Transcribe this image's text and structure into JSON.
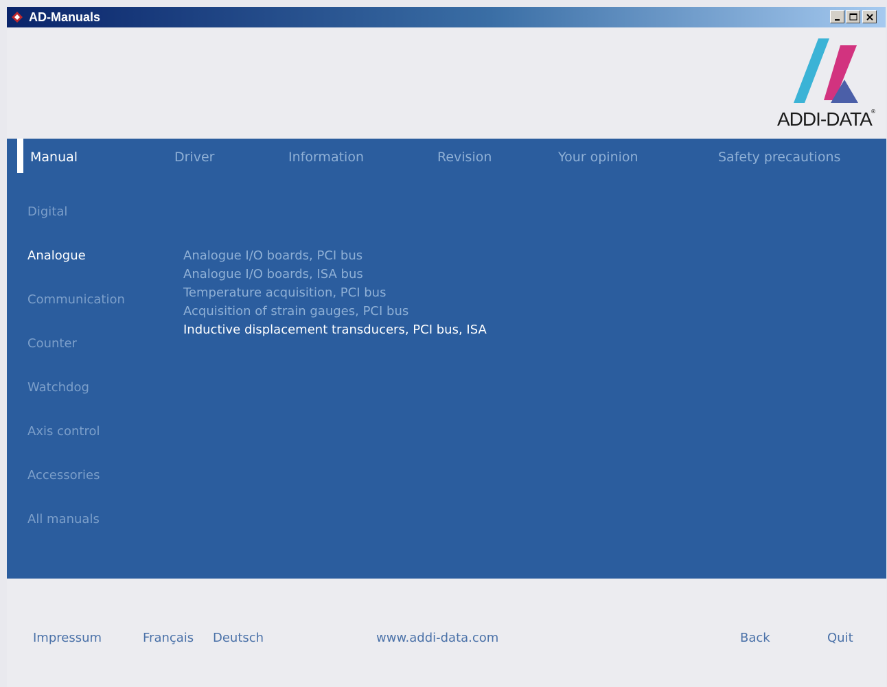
{
  "window": {
    "title": "AD-Manuals"
  },
  "logo": {
    "text": "ADDI-DATA",
    "registered": "®"
  },
  "tabs": [
    {
      "label": "Manual",
      "active": true
    },
    {
      "label": "Driver"
    },
    {
      "label": "Information"
    },
    {
      "label": "Revision"
    },
    {
      "label": "Your opinion"
    },
    {
      "label": "Safety precautions"
    }
  ],
  "categories": [
    {
      "label": "Digital"
    },
    {
      "label": "Analogue",
      "active": true
    },
    {
      "label": "Communication"
    },
    {
      "label": "Counter"
    },
    {
      "label": "Watchdog"
    },
    {
      "label": "Axis control"
    },
    {
      "label": "Accessories"
    },
    {
      "label": "All manuals"
    }
  ],
  "subitems": [
    {
      "label": "Analogue I/O boards, PCI bus"
    },
    {
      "label": "Analogue I/O boards, ISA bus"
    },
    {
      "label": "Temperature acquisition, PCI bus"
    },
    {
      "label": "Acquisition of strain gauges, PCI bus"
    },
    {
      "label": "Inductive displacement transducers, PCI bus, ISA",
      "highlighted": true
    }
  ],
  "footer": {
    "impressum": "Impressum",
    "francais": "Français",
    "deutsch": "Deutsch",
    "website": "www.addi-data.com",
    "back": "Back",
    "quit": "Quit"
  },
  "colors": {
    "panel": "#2b5d9e",
    "link_dim": "#8fb0d6",
    "link_active": "#ffffff",
    "footer_link": "#4a71a8",
    "logo_cyan": "#3bb3d6",
    "logo_magenta": "#d2337f"
  }
}
